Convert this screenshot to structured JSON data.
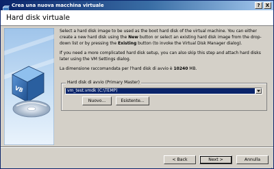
{
  "window": {
    "title": "Crea una nuova macchina virtuale",
    "help_label": "?",
    "close_label": "X"
  },
  "page": {
    "title": "Hard disk virtuale"
  },
  "paragraphs": {
    "p1": {
      "part1": "Select a hard disk image to be used as the boot hard disk of the virtual machine. You can either create a new hard disk using the ",
      "new_bold": "New",
      "part2": " button or select an existing hard disk image from the drop-down list or by pressing the ",
      "existing_bold": "Existing",
      "part3": " button (to invoke the Virtual Disk Manager dialog)."
    },
    "p2": "If you need a more complicated hard disk setup, you can also skip this step and attach hard disks later using the VM Settings dialog.",
    "p3": {
      "text": "La dimensione raccomandata per l'hard disk di avvio è ",
      "size": "10240",
      "unit": " MB."
    }
  },
  "boot_disk": {
    "group_label": "Hard disk di avvio (Primary Master)",
    "selected_value": "vm_test.vmdk (C:\\TEMP)",
    "new_label": "Nuovo...",
    "existing_label": "Esistente..."
  },
  "footer": {
    "back_label": "< Back",
    "next_label": "Next >",
    "cancel_label": "Annulla"
  },
  "colors": {
    "titlebar_start": "#0a246a",
    "titlebar_end": "#a6caf0",
    "selection": "#0a246a",
    "dialog_bg": "#d4d0c8"
  },
  "icons": {
    "app": "virtualbox-app-icon",
    "side": "virtualbox-wizard-image",
    "dropdown": "chevron-down-icon",
    "grip": "resize-grip-icon"
  }
}
